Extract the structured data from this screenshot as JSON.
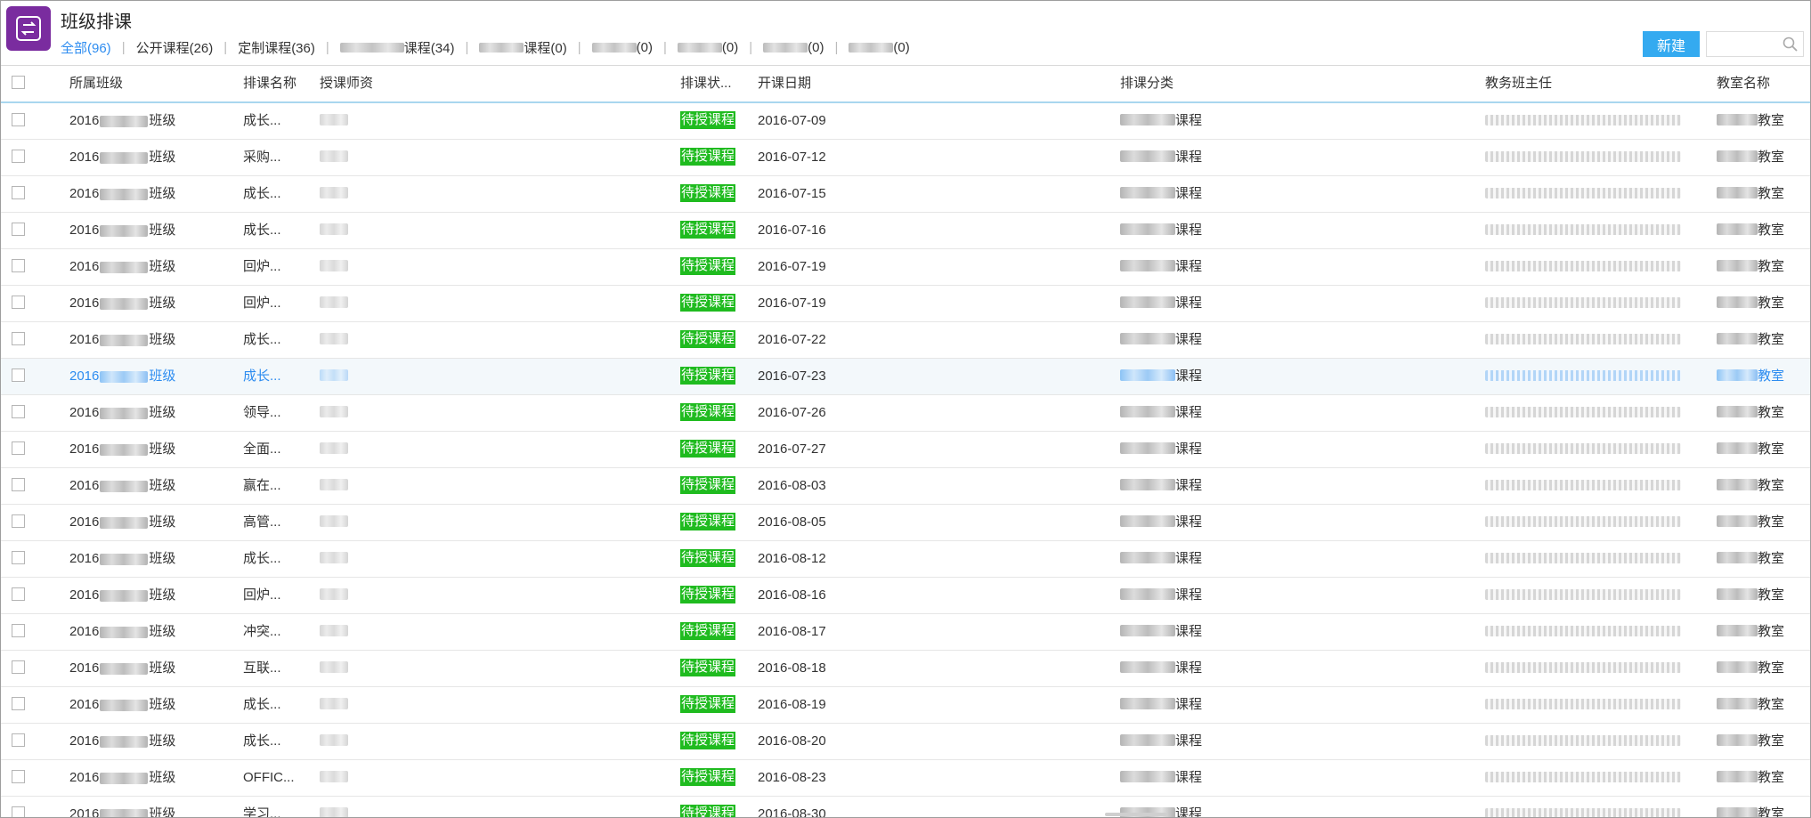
{
  "header": {
    "title": "班级排课",
    "new_label": "新建",
    "search_placeholder": ""
  },
  "tabs": [
    {
      "label": "全部(96)",
      "active": true
    },
    {
      "label": "公开课程(26)"
    },
    {
      "label": "定制课程(36)"
    },
    {
      "label": "课程(34)",
      "masked_prefix": true
    },
    {
      "label": "课程(0)",
      "masked_prefix": true
    },
    {
      "label": "(0)",
      "masked_prefix": true
    },
    {
      "label": "(0)",
      "masked_prefix": true
    },
    {
      "label": "(0)",
      "masked_prefix": true
    },
    {
      "label": "(0)",
      "masked_prefix": true
    }
  ],
  "columns": {
    "class": "所属班级",
    "name": "排课名称",
    "teacher": "授课师资",
    "status": "排课状...",
    "date": "开课日期",
    "category": "排课分类",
    "head": "教务班主任",
    "room": "教室名称"
  },
  "row_fixed": {
    "class_prefix": "2016",
    "class_suffix": "班级",
    "status": "待授课程",
    "category_suffix": "课程",
    "room_suffix": "教室"
  },
  "rows": [
    {
      "name": "成长...",
      "date": "2016-07-09"
    },
    {
      "name": "采购...",
      "date": "2016-07-12"
    },
    {
      "name": "成长...",
      "date": "2016-07-15"
    },
    {
      "name": "成长...",
      "date": "2016-07-16"
    },
    {
      "name": "回炉...",
      "date": "2016-07-19"
    },
    {
      "name": "回炉...",
      "date": "2016-07-19"
    },
    {
      "name": "成长...",
      "date": "2016-07-22"
    },
    {
      "name": "成长...",
      "date": "2016-07-23",
      "highlighted": true
    },
    {
      "name": "领导...",
      "date": "2016-07-26"
    },
    {
      "name": "全面...",
      "date": "2016-07-27"
    },
    {
      "name": "赢在...",
      "date": "2016-08-03"
    },
    {
      "name": "高管...",
      "date": "2016-08-05"
    },
    {
      "name": "成长...",
      "date": "2016-08-12"
    },
    {
      "name": "回炉...",
      "date": "2016-08-16"
    },
    {
      "name": "冲突...",
      "date": "2016-08-17"
    },
    {
      "name": "互联...",
      "date": "2016-08-18"
    },
    {
      "name": "成长...",
      "date": "2016-08-19"
    },
    {
      "name": "成长...",
      "date": "2016-08-20"
    },
    {
      "name": "OFFIC...",
      "date": "2016-08-23"
    },
    {
      "name": "学习...",
      "date": "2016-08-30"
    }
  ],
  "colors": {
    "accent": "#2d8cf0",
    "status_badge": "#1fbb1f",
    "new_button": "#34aaf0",
    "app_icon": "#7a2c9f"
  }
}
